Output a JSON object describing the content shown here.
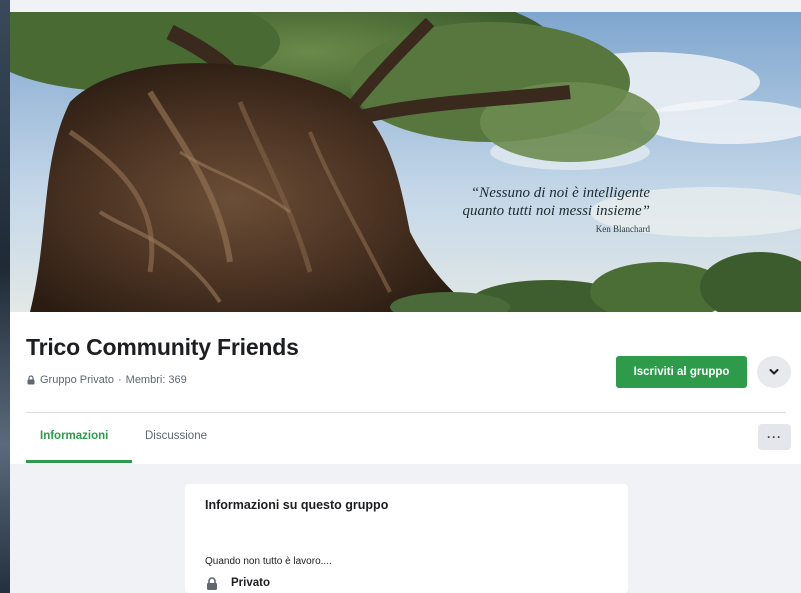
{
  "cover": {
    "quote_line_1": "“Nessuno di noi è intelligente",
    "quote_line_2": "quanto tutti noi messi insieme”",
    "quote_author": "Ken Blanchard"
  },
  "group": {
    "name": "Trico Community Friends",
    "privacy_label": "Gruppo Privato",
    "separator": "·",
    "members_text": "Membri: 369",
    "join_button_label": "Iscriviti al gruppo",
    "brand_color": "#2d9b4a"
  },
  "tabs": [
    {
      "label": "Informazioni",
      "active": true
    },
    {
      "label": "Discussione",
      "active": false
    }
  ],
  "more_button_label": "···",
  "about": {
    "title": "Informazioni su questo gruppo",
    "description": "Quando non tutto è lavoro....",
    "privacy_title": "Privato"
  },
  "icons": {
    "lock": "lock-icon",
    "chevron": "chevron-down-icon"
  }
}
